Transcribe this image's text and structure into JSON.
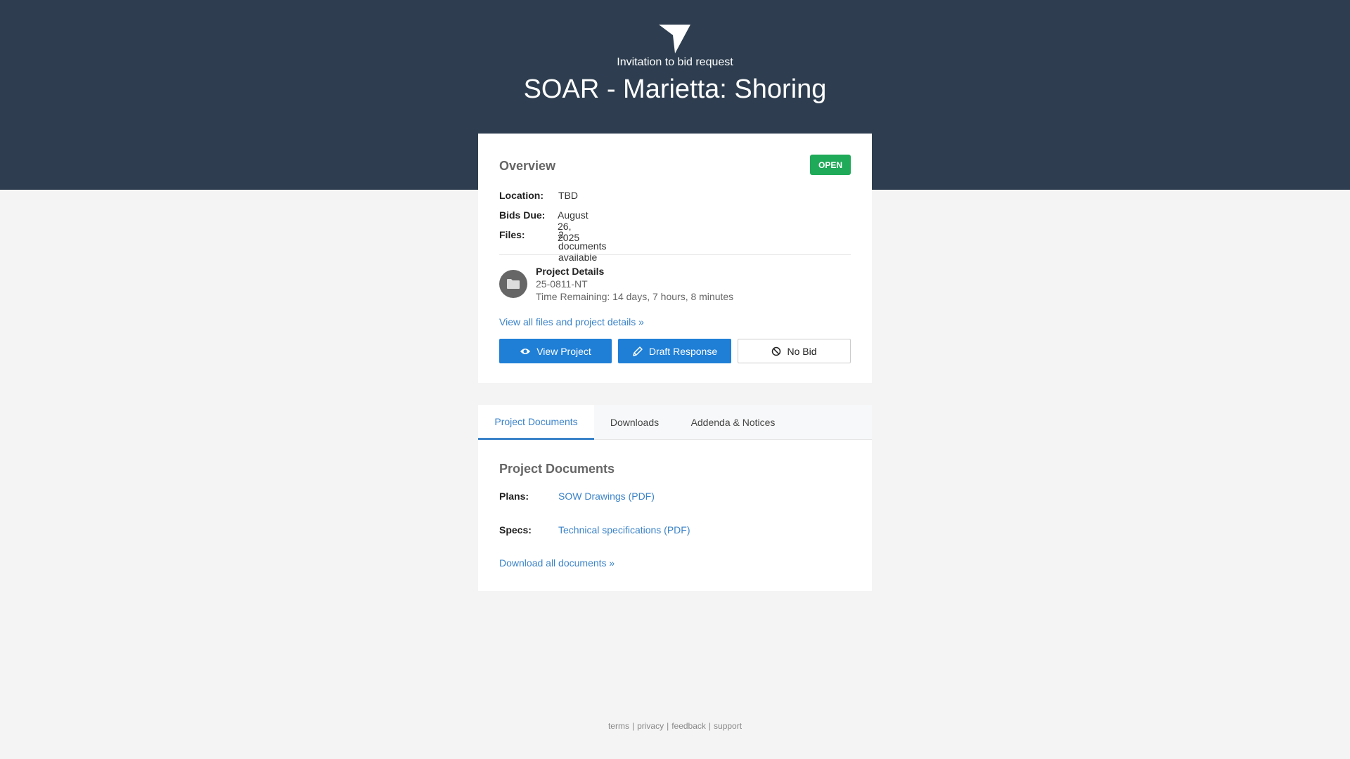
{
  "header": {
    "logo_icon": "paper-plane-icon",
    "subtitle": "Invitation to bid request",
    "title": "SOAR - Marietta: Shoring"
  },
  "overview": {
    "title": "Overview",
    "status": "OPEN",
    "status_color": "#1faa59",
    "location_label": "Location:",
    "location_value": "TBD",
    "bids_due_label": "Bids Due:",
    "bids_due_value": "August 26, 2025",
    "files_label": "Files:",
    "files_value": "2 documents available",
    "details_icon": "folder-icon",
    "details_title": "Project Details",
    "details_id": "25-0811-NT",
    "time_remaining": "Time Remaining: 14 days, 7 hours, 8 minutes",
    "view_all_link": "View all files and project details »",
    "buttons": {
      "view_project": "View Project",
      "view_project_icon": "eye-icon",
      "draft_response": "Draft Response",
      "draft_response_icon": "pencil-icon",
      "no_bid": "No Bid",
      "no_bid_icon": "ban-icon"
    },
    "accent_color": "#1f7fd6"
  },
  "tabs": [
    {
      "label": "Project Documents",
      "active": true
    },
    {
      "label": "Downloads",
      "active": false
    },
    {
      "label": "Addenda & Notices",
      "active": false
    }
  ],
  "documents": {
    "title": "Project Documents",
    "plans_label": "Plans:",
    "plans_link": "SOW Drawings (PDF)",
    "specs_label": "Specs:",
    "specs_link": "Technical specifications (PDF)",
    "download_all": "Download all documents »"
  },
  "footer": {
    "links": [
      "terms",
      "privacy",
      "feedback",
      "support"
    ],
    "separator": "|"
  }
}
